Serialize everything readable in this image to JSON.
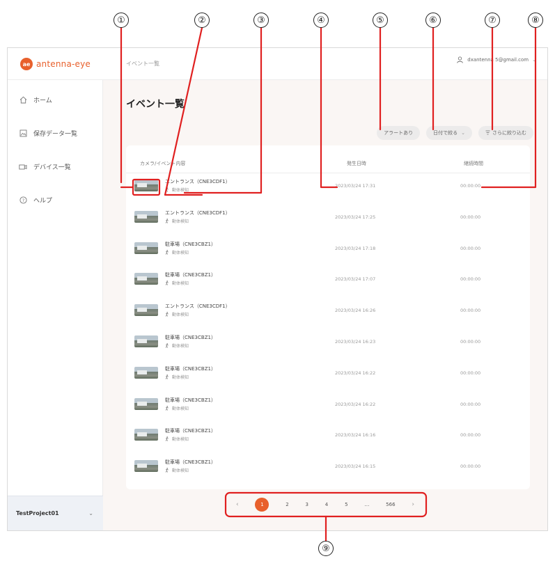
{
  "app": {
    "logo_mark": "ae",
    "logo_text": "antenna-eye",
    "breadcrumb": "イベント一覧",
    "user_email": "dxantenna 5@gmail.com",
    "accent_color": "#e8602c"
  },
  "sidebar": {
    "items": [
      {
        "label": "ホーム",
        "icon": "home-icon"
      },
      {
        "label": "保存データ一覧",
        "icon": "image-icon"
      },
      {
        "label": "デバイス一覧",
        "icon": "camera-icon"
      },
      {
        "label": "ヘルプ",
        "icon": "help-icon"
      }
    ],
    "project": "TestProject01"
  },
  "main": {
    "title": "イベント一覧",
    "filters": {
      "alert": "アラートあり",
      "date": "日付で絞る",
      "more": "さらに絞り込む"
    },
    "columns": {
      "camera": "カメラ/イベント内容",
      "datetime": "発生日時",
      "duration": "継続時間"
    },
    "rows": [
      {
        "camera": "エントランス（CNE3CDF1）",
        "event": "動体検知",
        "datetime": "2023/03/24 17:31",
        "duration": "00:00:00"
      },
      {
        "camera": "エントランス（CNE3CDF1）",
        "event": "動体検知",
        "datetime": "2023/03/24 17:25",
        "duration": "00:00:00"
      },
      {
        "camera": "駐車場（CNE3CBZ1）",
        "event": "動体検知",
        "datetime": "2023/03/24 17:18",
        "duration": "00:00:00"
      },
      {
        "camera": "駐車場（CNE3CBZ1）",
        "event": "動体検知",
        "datetime": "2023/03/24 17:07",
        "duration": "00:00:00"
      },
      {
        "camera": "エントランス（CNE3CDF1）",
        "event": "動体検知",
        "datetime": "2023/03/24 16:26",
        "duration": "00:00:00"
      },
      {
        "camera": "駐車場（CNE3CBZ1）",
        "event": "動体検知",
        "datetime": "2023/03/24 16:23",
        "duration": "00:00:00"
      },
      {
        "camera": "駐車場（CNE3CBZ1）",
        "event": "動体検知",
        "datetime": "2023/03/24 16:22",
        "duration": "00:00:00"
      },
      {
        "camera": "駐車場（CNE3CBZ1）",
        "event": "動体検知",
        "datetime": "2023/03/24 16:22",
        "duration": "00:00:00"
      },
      {
        "camera": "駐車場（CNE3CBZ1）",
        "event": "動体検知",
        "datetime": "2023/03/24 16:16",
        "duration": "00:00:00"
      },
      {
        "camera": "駐車場（CNE3CBZ1）",
        "event": "動体検知",
        "datetime": "2023/03/24 16:15",
        "duration": "00:00:00"
      }
    ]
  },
  "pagination": {
    "prev": "‹",
    "pages": [
      "1",
      "2",
      "3",
      "4",
      "5",
      "…",
      "566"
    ],
    "current": "1",
    "next": "›"
  },
  "callouts": [
    "①",
    "②",
    "③",
    "④",
    "⑤",
    "⑥",
    "⑦",
    "⑧",
    "⑨"
  ],
  "callout_color": "#e02020"
}
